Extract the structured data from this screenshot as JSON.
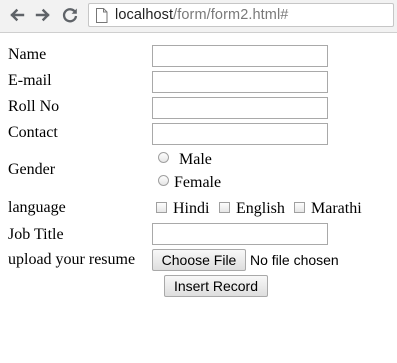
{
  "browser": {
    "url_host": "localhost",
    "url_path": "/form/form2.html#"
  },
  "form": {
    "name_label": "Name",
    "email_label": "E-mail",
    "roll_label": "Roll No",
    "contact_label": "Contact",
    "gender_label": "Gender",
    "gender_options": [
      "Male",
      "Female"
    ],
    "language_label": "language",
    "language_options": [
      "Hindi",
      "English",
      "Marathi"
    ],
    "job_label": "Job Title",
    "resume_label": "upload your resume",
    "choose_file_label": "Choose File",
    "file_status": "No file chosen",
    "submit_label": "Insert Record",
    "fields": {
      "name": "",
      "email": "",
      "roll": "",
      "contact": "",
      "job": ""
    }
  },
  "colors": {
    "chrome": "#f2f2f2",
    "input_border": "#a9a9a9"
  }
}
